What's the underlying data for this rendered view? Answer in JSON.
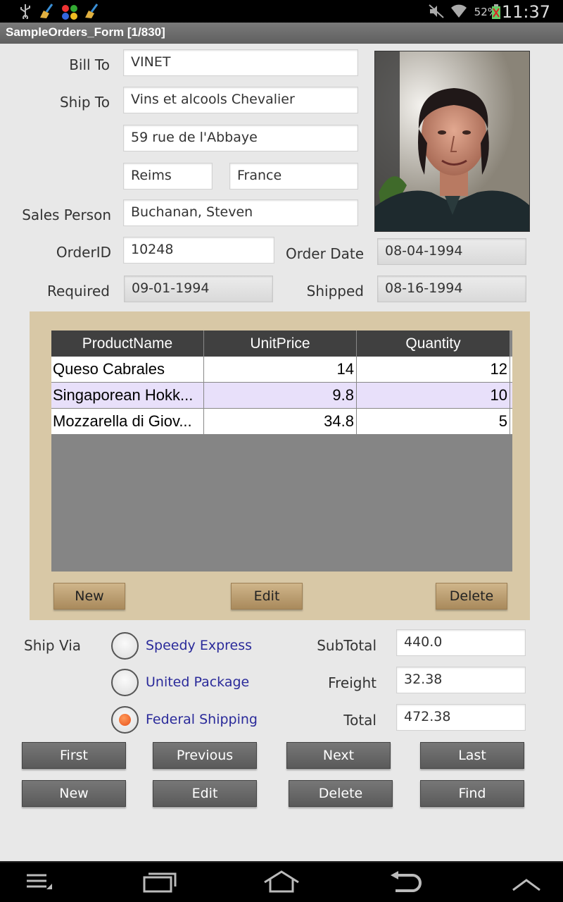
{
  "status_bar": {
    "left_icons": [
      "usb-icon",
      "broom-icon",
      "app-icon",
      "broom-icon"
    ],
    "battery": "52%",
    "time": "11:37"
  },
  "window": {
    "title": "SampleOrders_Form [1/830]"
  },
  "form": {
    "bill_to": {
      "label": "Bill To",
      "value": "VINET"
    },
    "ship_to": {
      "label": "Ship To",
      "name": "Vins et alcools Chevalier",
      "address": "59 rue de l'Abbaye",
      "city": "Reims",
      "country": "France"
    },
    "sales_person": {
      "label": "Sales Person",
      "value": "Buchanan, Steven"
    },
    "order_id": {
      "label": "OrderID",
      "value": "10248"
    },
    "order_date": {
      "label": "Order Date",
      "value": "08-04-1994"
    },
    "required": {
      "label": "Required",
      "value": "09-01-1994"
    },
    "shipped": {
      "label": "Shipped",
      "value": "08-16-1994"
    }
  },
  "grid": {
    "columns": [
      "ProductName",
      "UnitPrice",
      "Quantity"
    ],
    "rows": [
      {
        "product": "Queso Cabrales",
        "price": "14",
        "qty": "12"
      },
      {
        "product": "Singaporean Hokk...",
        "price": "9.8",
        "qty": "10"
      },
      {
        "product": "Mozzarella di Giov...",
        "price": "34.8",
        "qty": "5"
      }
    ],
    "buttons": {
      "new": "New",
      "edit": "Edit",
      "delete": "Delete"
    }
  },
  "ship_via": {
    "label": "Ship Via",
    "options": [
      "Speedy Express",
      "United Package",
      "Federal Shipping"
    ],
    "selected": "Federal Shipping"
  },
  "totals": {
    "subtotal": {
      "label": "SubTotal",
      "value": "440.0"
    },
    "freight": {
      "label": "Freight",
      "value": "32.38"
    },
    "total": {
      "label": "Total",
      "value": "472.38"
    }
  },
  "nav_buttons": {
    "first": "First",
    "previous": "Previous",
    "next": "Next",
    "last": "Last"
  },
  "action_buttons": {
    "new": "New",
    "edit": "Edit",
    "delete": "Delete",
    "find": "Find"
  },
  "nav_bar": [
    "menu-icon",
    "recent-apps-icon",
    "home-icon",
    "back-icon",
    "up-icon"
  ]
}
